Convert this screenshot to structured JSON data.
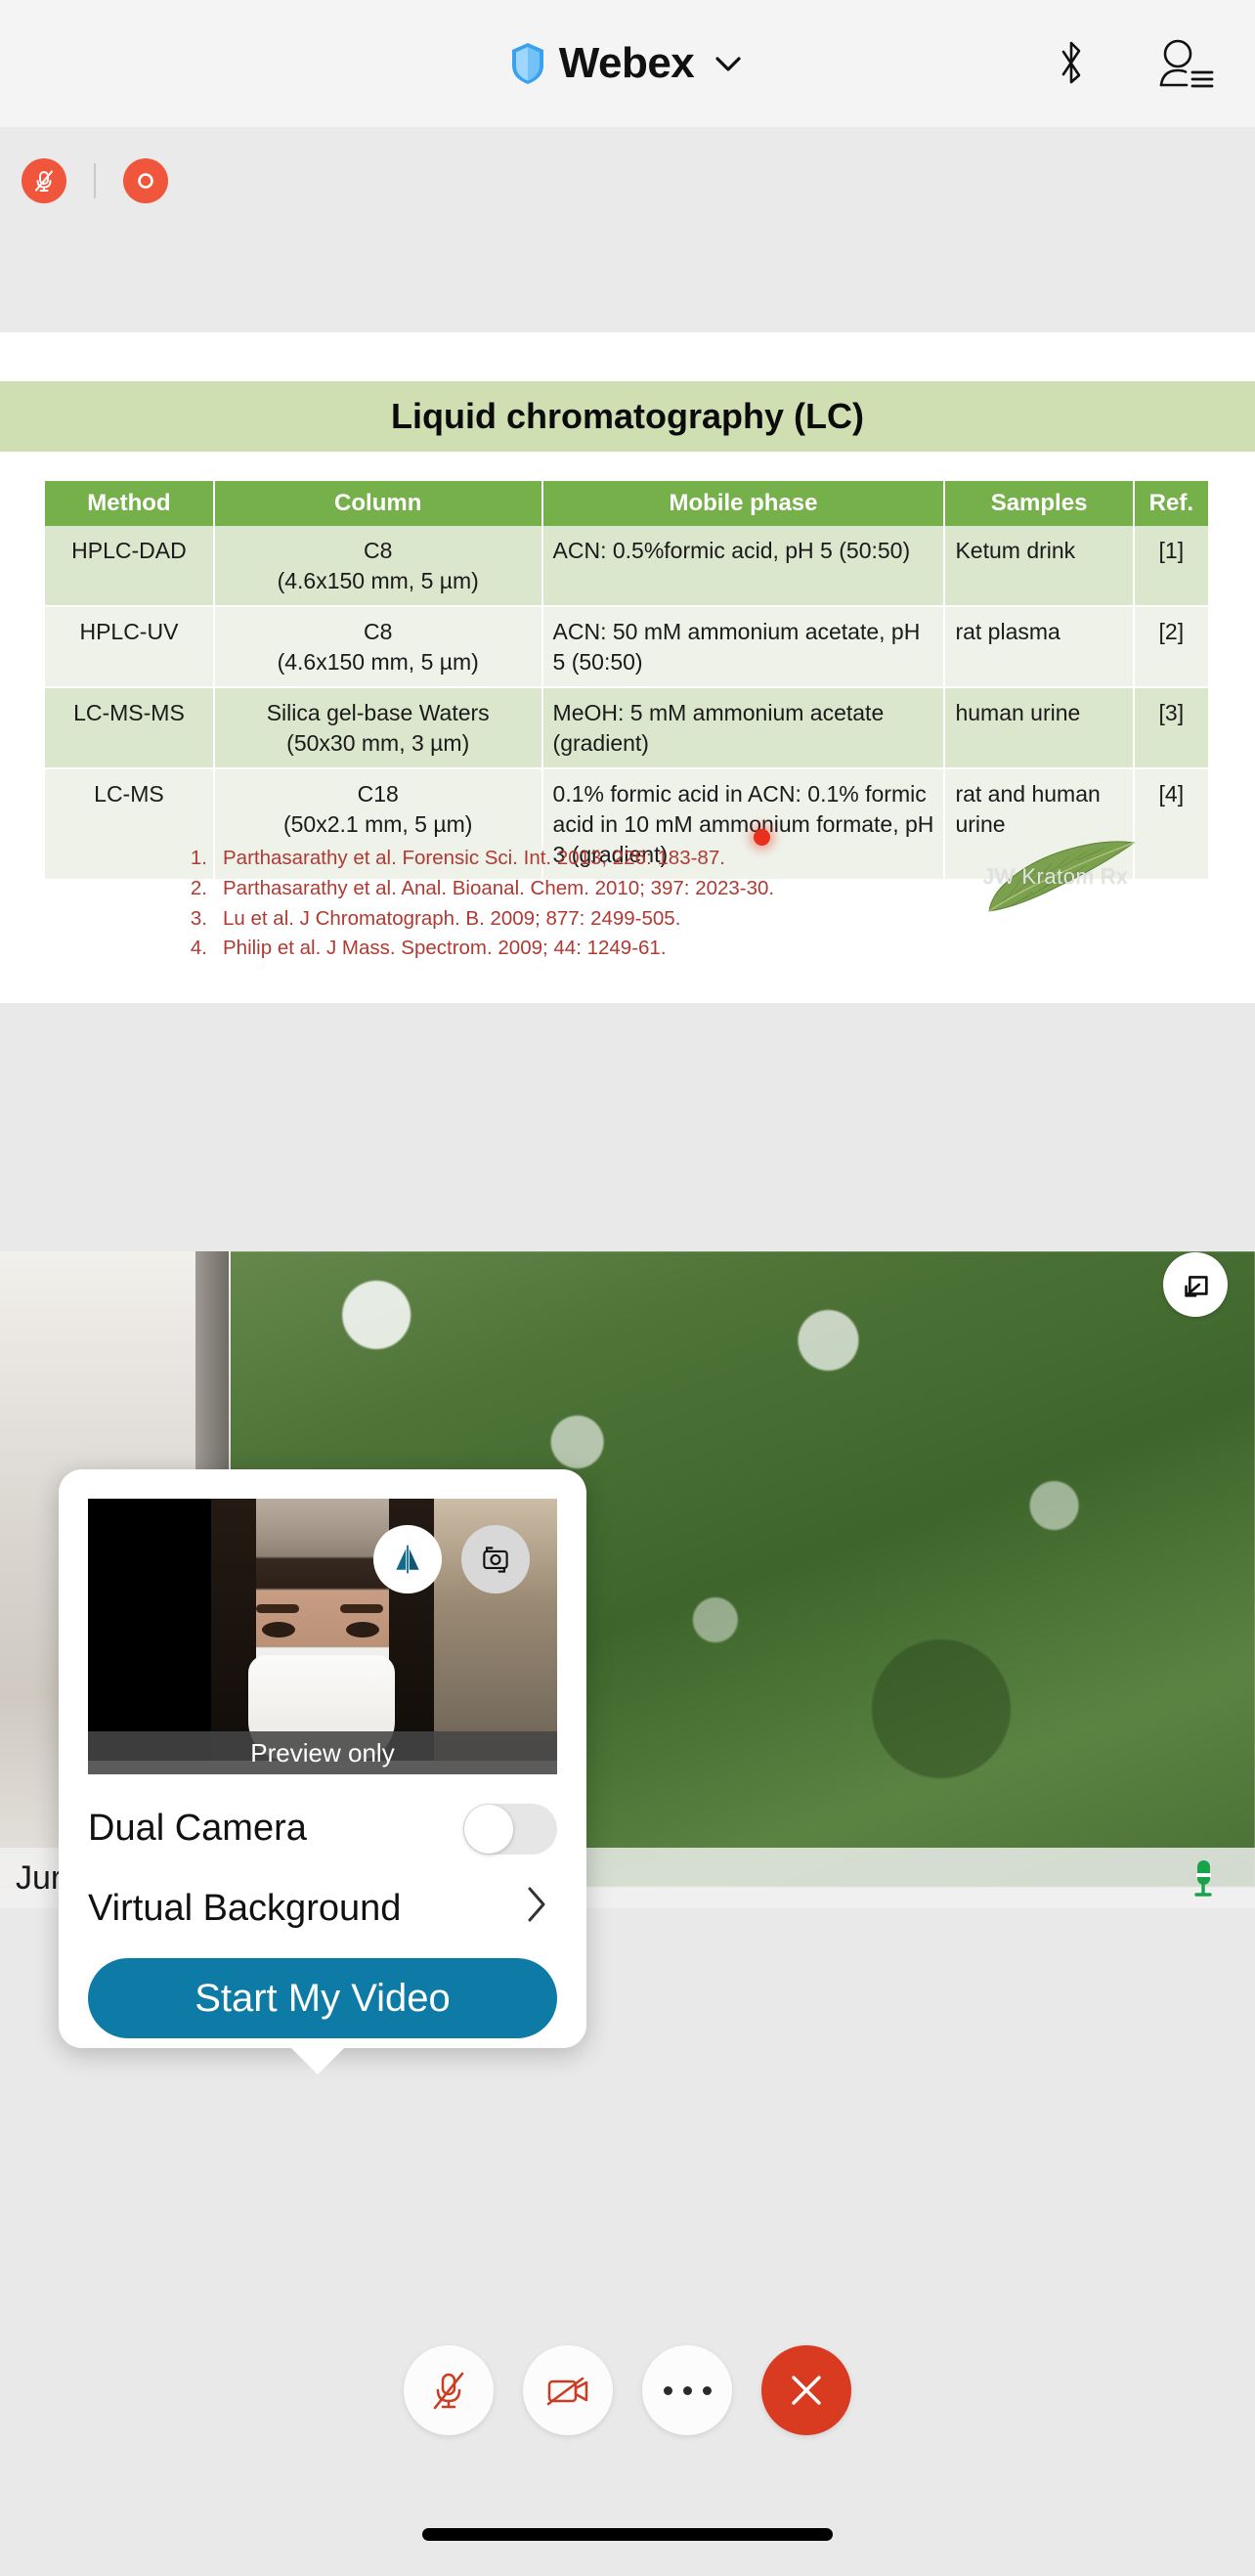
{
  "topbar": {
    "app_title": "Webex",
    "shield_icon": "shield-icon",
    "chevron_icon": "chevron-down-icon",
    "bluetooth_icon": "bluetooth-icon",
    "participants_icon": "participants-icon"
  },
  "status_badges": [
    {
      "name": "mic-muted-badge",
      "icon": "microphone-muted-icon",
      "color": "#f0563c"
    },
    {
      "name": "recording-badge",
      "icon": "record-circle-icon",
      "color": "#f0563c"
    }
  ],
  "slide": {
    "title": "Liquid chromatography (LC)",
    "title_bg": "#cfdfb2",
    "header_bg": "#76b04a",
    "table": {
      "columns": [
        "Method",
        "Column",
        "Mobile phase",
        "Samples",
        "Ref."
      ],
      "rows": [
        {
          "method": "HPLC-DAD",
          "column": "C8\n(4.6x150 mm, 5 µm)",
          "mobile_phase": "ACN: 0.5%formic acid, pH 5 (50:50)",
          "samples": "Ketum drink",
          "ref": "[1]"
        },
        {
          "method": "HPLC-UV",
          "column": "C8\n(4.6x150 mm, 5 µm)",
          "mobile_phase": "ACN: 50 mM ammonium acetate, pH 5 (50:50)",
          "samples": "rat plasma",
          "ref": "[2]"
        },
        {
          "method": "LC-MS-MS",
          "column": "Silica gel-base Waters\n(50x30 mm, 3 µm)",
          "mobile_phase": "MeOH: 5 mM ammonium acetate (gradient)",
          "samples": "human urine",
          "ref": "[3]"
        },
        {
          "method": "LC-MS",
          "column": "C18\n(50x2.1 mm, 5 µm)",
          "mobile_phase": "0.1% formic acid in ACN: 0.1% formic acid in 10 mM ammonium formate, pH 3 (gradient)",
          "samples": "rat and human urine",
          "ref": "[4]"
        }
      ]
    },
    "references": [
      {
        "num": "1.",
        "text": "Parthasarathy et al. Forensic Sci. Int. 2013; 226: 183-87."
      },
      {
        "num": "2.",
        "text": "Parthasarathy et al. Anal. Bioanal. Chem. 2010; 397: 2023-30."
      },
      {
        "num": "3.",
        "text": "Lu et al. J Chromatograph. B. 2009; 877: 2499-505."
      },
      {
        "num": "4.",
        "text": "Philip et al. J Mass. Spectrom. 2009; 44: 1249-61."
      }
    ],
    "reference_color": "#b03a33",
    "logo_watermark": "JW Kratom Rx",
    "laser_pointer_color": "#e8301c"
  },
  "stage": {
    "participant_name": "Jura",
    "expand_icon": "collapse-arrow-icon",
    "mic_active_icon": "microphone-active-icon",
    "mic_active_color": "#17a34a"
  },
  "popup": {
    "preview_label": "Preview only",
    "flip_icon": "flip-camera-horizontal-icon",
    "switch_icon": "switch-camera-icon",
    "options": [
      {
        "name": "dual-camera",
        "label": "Dual Camera",
        "control": "toggle",
        "value": "off"
      },
      {
        "name": "virtual-background",
        "label": "Virtual Background",
        "control": "chevron"
      }
    ],
    "primary_button": {
      "label": "Start My Video",
      "color": "#0d7ba5"
    }
  },
  "controlbar": {
    "buttons": [
      {
        "name": "mic-button",
        "icon": "microphone-muted-icon",
        "state": "muted",
        "color": "#cc3c21"
      },
      {
        "name": "video-button",
        "icon": "video-off-icon",
        "state": "off",
        "color": "#cc3c21"
      },
      {
        "name": "more-button",
        "icon": "more-options-icon"
      },
      {
        "name": "leave-button",
        "icon": "close-x-icon",
        "color": "#d93b21"
      }
    ]
  }
}
